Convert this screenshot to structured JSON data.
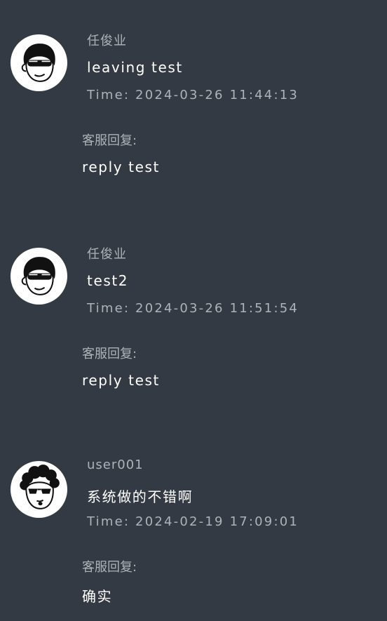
{
  "messages": [
    {
      "user": "任俊业",
      "content": "leaving test",
      "time": "Time: 2024-03-26 11:44:13",
      "reply_label": "客服回复:",
      "reply": "reply test",
      "avatar_icon": "goggles-man-avatar-icon"
    },
    {
      "user": "任俊业",
      "content": "test2",
      "time": "Time: 2024-03-26 11:51:54",
      "reply_label": "客服回复:",
      "reply": "reply test",
      "avatar_icon": "goggles-man-avatar-icon"
    },
    {
      "user": "user001",
      "content": "系统做的不错啊",
      "time": "Time: 2024-02-19 17:09:01",
      "reply_label": "客服回复:",
      "reply": "确实",
      "avatar_icon": "sunglasses-man-avatar-icon"
    }
  ],
  "colors": {
    "background": "#343a43",
    "muted_text": "#aeb3ba",
    "primary_text": "#ffffff"
  }
}
